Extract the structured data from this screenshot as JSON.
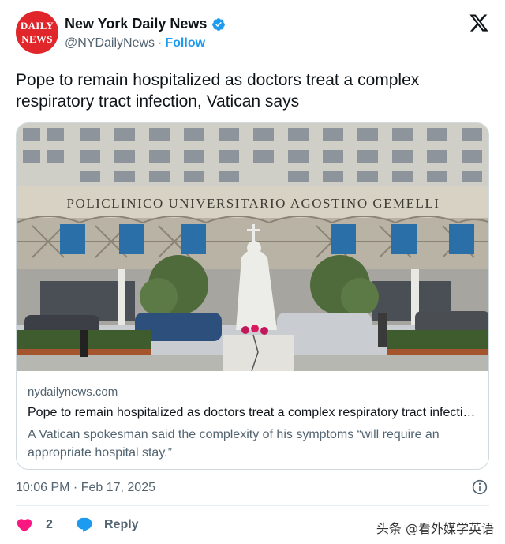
{
  "account": {
    "avatar_line1": "DAILY",
    "avatar_line2": "NEWS",
    "display_name": "New York Daily News",
    "handle": "@NYDailyNews",
    "separator": "·",
    "follow_label": "Follow",
    "verified_color": "#1d9bf0"
  },
  "tweet": {
    "text": "Pope to remain hospitalized as doctors treat a complex respiratory tract infection, Vatican says"
  },
  "link_card": {
    "photo_sign": "POLICLINICO UNIVERSITARIO AGOSTINO GEMELLI",
    "domain": "nydailynews.com",
    "title": "Pope to remain hospitalized as doctors treat a complex respiratory tract infection, Vatican says",
    "description": "A Vatican spokesman said the complexity of his symptoms “will require an appropriate hospital stay.”"
  },
  "meta": {
    "timestamp": "10:06 PM · Feb 17, 2025"
  },
  "actions": {
    "like_count": "2",
    "reply_label": "Reply",
    "like_color": "#f91880",
    "reply_color": "#1d9bf0"
  },
  "watermark": "头条 @看外媒学英语",
  "icons": [
    "verified-badge-icon",
    "x-logo-icon",
    "info-icon",
    "heart-icon",
    "reply-bubble-icon"
  ]
}
